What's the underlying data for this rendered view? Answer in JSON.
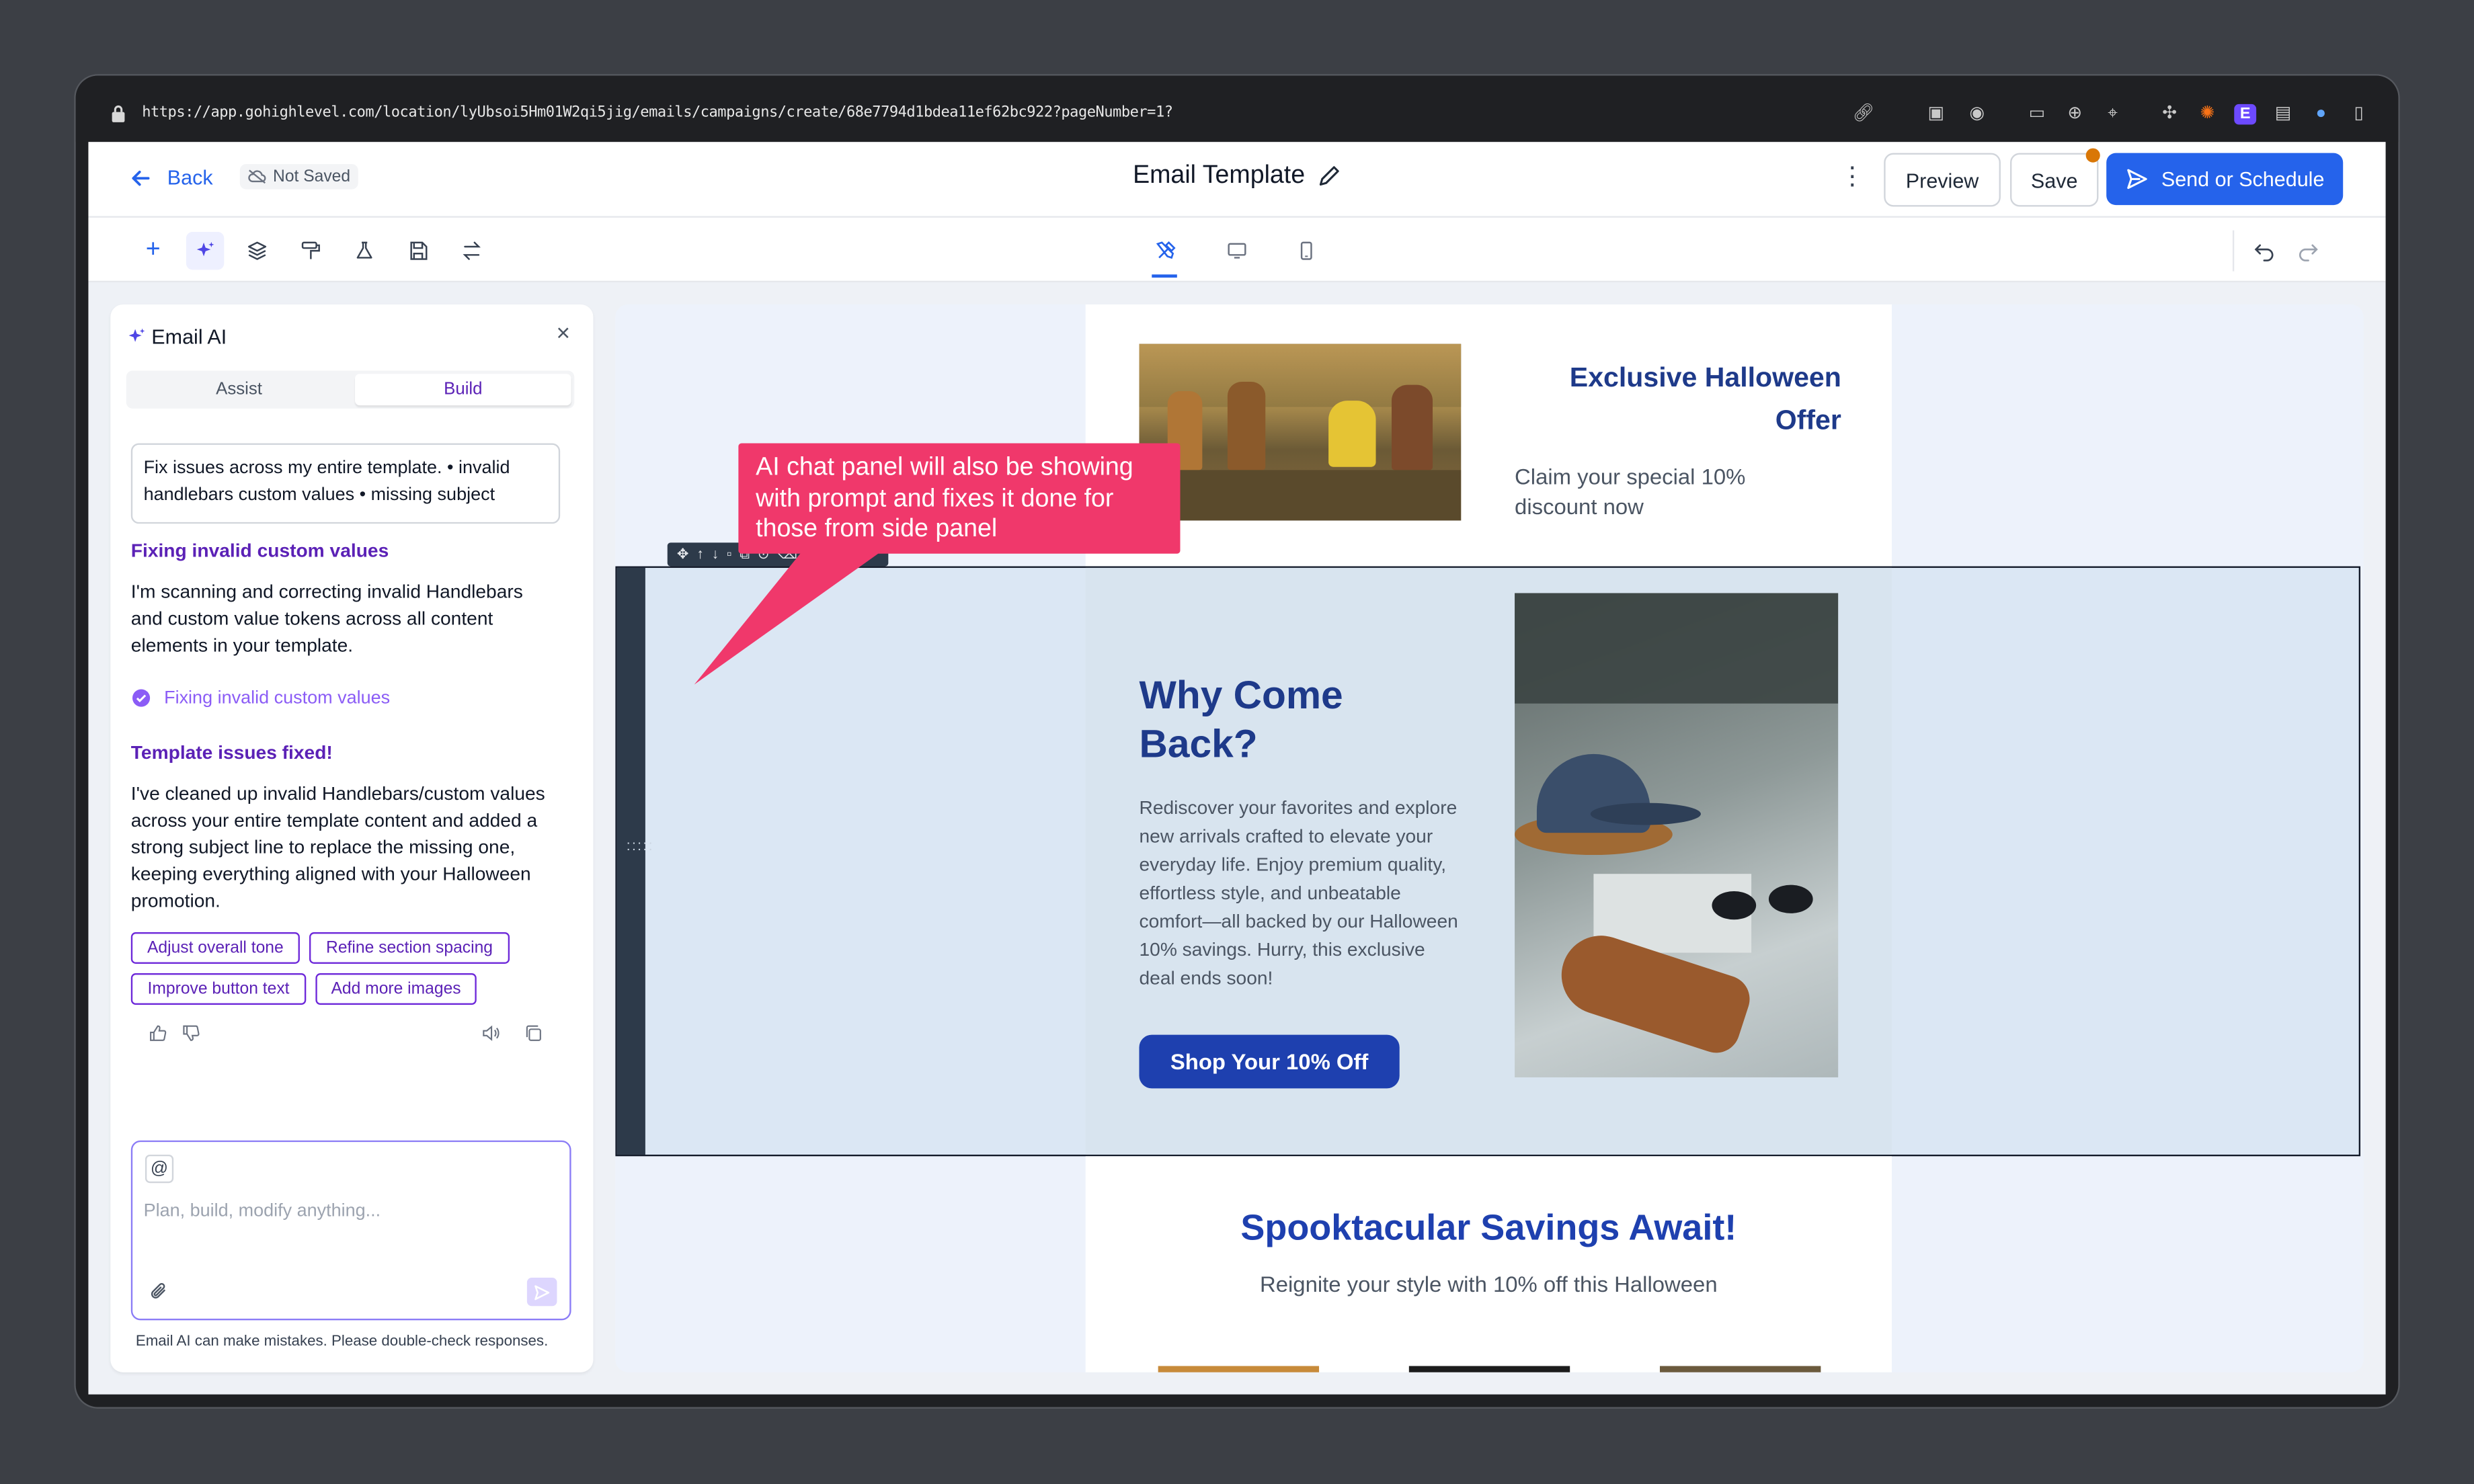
{
  "browser": {
    "url": "https://app.gohighlevel.com/location/lyUbsoi5Hm01W2qi5jig/emails/campaigns/create/68e7794d1bdea11ef62bc922?pageNumber=1?"
  },
  "header": {
    "back_label": "Back",
    "save_status": "Not Saved",
    "title": "Email Template",
    "preview_label": "Preview",
    "save_label": "Save",
    "send_label": "Send or Schedule",
    "accent": "#2563eb"
  },
  "ai_panel": {
    "title": "Email AI",
    "tabs": [
      "Assist",
      "Build"
    ],
    "active_tab": "Build",
    "prompt": "Fix issues across my entire template. • invalid handlebars custom values • missing subject",
    "step_heading": "Fixing invalid custom values",
    "step_body": "I'm scanning and correcting invalid Handlebars and custom value tokens across all content elements in your template.",
    "step_status": "Fixing invalid custom values",
    "result_heading": "Template issues fixed!",
    "result_body": "I've cleaned up invalid Handlebars/custom values across your entire template content and added a strong subject line to replace the missing one, keeping everything aligned with your Halloween promotion.",
    "suggestions": [
      "Adjust overall tone",
      "Refine section spacing",
      "Improve button text",
      "Add more images"
    ],
    "input_placeholder": "Plan, build, modify anything...",
    "disclaimer": "Email AI can make mistakes. Please double-check responses.",
    "accent": "#5b21b6"
  },
  "email": {
    "offer_title": "Exclusive Halloween Offer",
    "offer_sub": "Claim your special 10% discount now",
    "why_title": "Why Come Back?",
    "why_body": "Rediscover your favorites and explore new arrivals crafted to elevate your everyday life. Enjoy premium quality, effortless style, and unbeatable comfort—all backed by our Halloween 10% savings. Hurry, this exclusive deal ends soon!",
    "cta_label": "Shop Your 10% Off",
    "savings_title": "Spooktacular Savings Await!",
    "savings_sub": "Reignite your style with 10% off this Halloween",
    "brand_blue": "#1e3a8a"
  },
  "annotation": {
    "text": "AI chat panel will also be showing with prompt and fixes it done for those from side panel",
    "color": "#f0386b"
  }
}
